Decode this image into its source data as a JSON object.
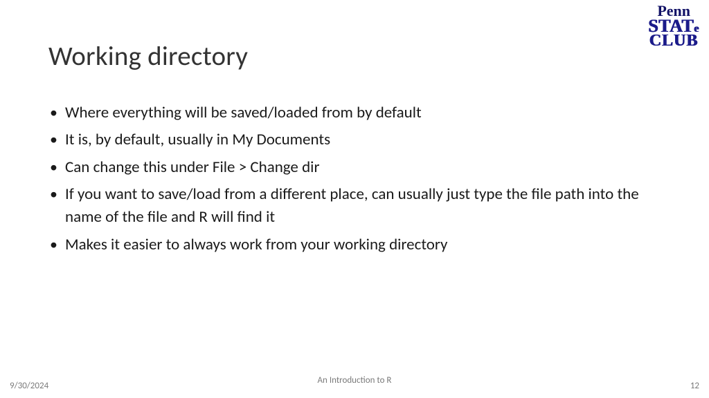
{
  "title": "Working directory",
  "bullets": [
    "Where everything will be saved/loaded from by default",
    "It is, by default, usually in My Documents",
    "Can change this under File > Change dir",
    "If you want to save/load from a different place, can usually just type the file path into the name of the file and R will find it",
    "Makes it easier to always work from your working directory"
  ],
  "logo": {
    "line1": "Penn",
    "line2_main": "STAT",
    "line2_suffix": "e",
    "line3": "CLUB"
  },
  "footer": {
    "date": "9/30/2024",
    "subtitle": "An Introduction to R",
    "page": "12"
  }
}
